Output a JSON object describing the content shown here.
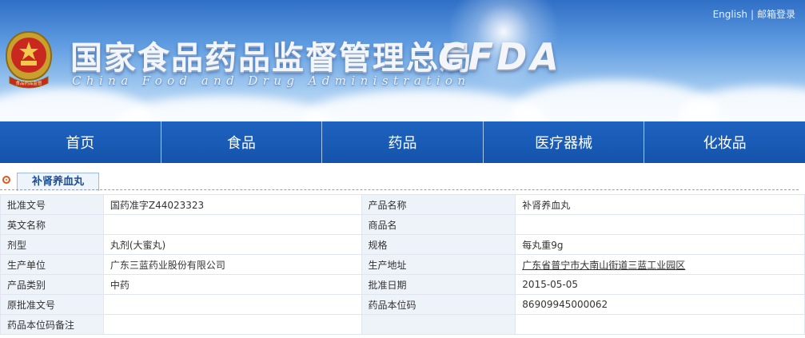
{
  "header": {
    "links": [
      "English",
      "邮箱登录"
    ],
    "link_separator": "|",
    "title_cn": "国家食品药品监督管理总局",
    "title_en": "China Food and Drug Administration",
    "logo_text": "CFDA",
    "emblem_text": "食品药品监督"
  },
  "nav": {
    "items": [
      "首页",
      "食品",
      "药品",
      "医疗器械",
      "化妆品"
    ]
  },
  "section": {
    "tab_label": "补肾养血丸"
  },
  "details": {
    "rows": [
      {
        "l1": "批准文号",
        "v1": "国药准字Z44023323",
        "l2": "产品名称",
        "v2": "补肾养血丸"
      },
      {
        "l1": "英文名称",
        "v1": "",
        "l2": "商品名",
        "v2": ""
      },
      {
        "l1": "剂型",
        "v1": "丸剂(大蜜丸)",
        "l2": "规格",
        "v2": "每丸重9g"
      },
      {
        "l1": "生产单位",
        "v1": "广东三蓝药业股份有限公司",
        "l2": "生产地址",
        "v2": "广东省普宁市大南山街道三蓝工业园区"
      },
      {
        "l1": "产品类别",
        "v1": "中药",
        "l2": "批准日期",
        "v2": "2015-05-05"
      },
      {
        "l1": "原批准文号",
        "v1": "",
        "l2": "药品本位码",
        "v2": "86909945000062"
      },
      {
        "l1": "药品本位码备注",
        "v1": "",
        "l2": "",
        "v2": ""
      }
    ]
  },
  "colors": {
    "nav_bg": "#1a5cb5",
    "label_bg": "#eef3fa",
    "accent": "#e2571b"
  }
}
